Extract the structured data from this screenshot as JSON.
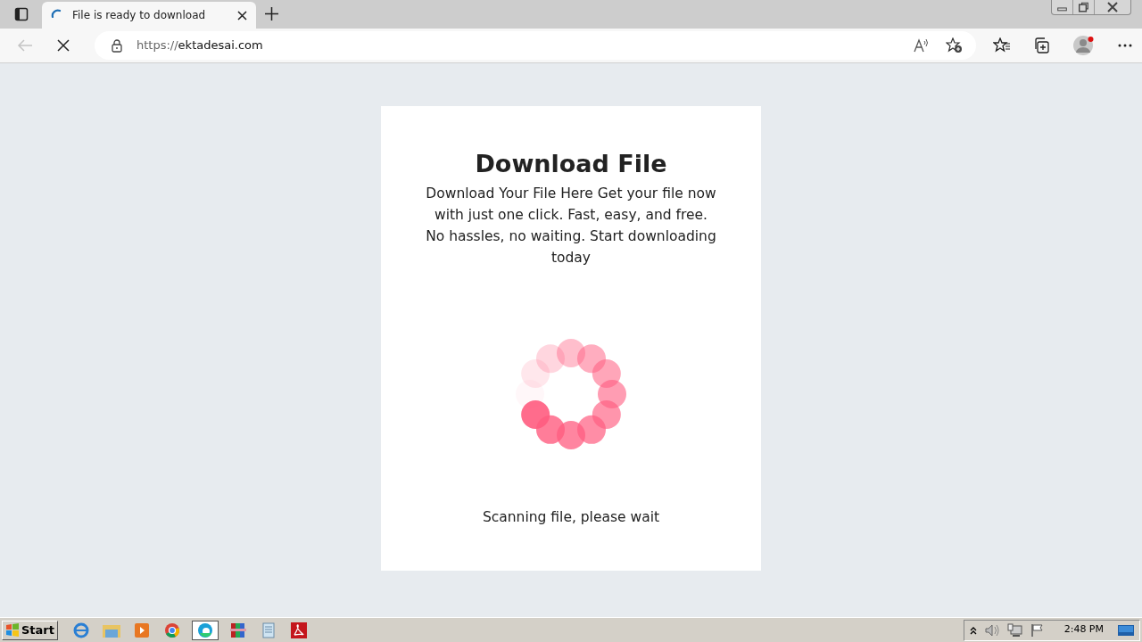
{
  "browser": {
    "tab": {
      "title": "File is ready to download",
      "selected": true
    },
    "address": {
      "scheme": "https://",
      "host": "ektadesai.com"
    }
  },
  "page": {
    "title": "Download File",
    "description": "Download Your File Here Get your file now with just one click. Fast, easy, and free. No hassles, no waiting. Start downloading today",
    "status": "Scanning file, please wait"
  },
  "taskbar": {
    "start": "Start",
    "clock": "2:48 PM"
  }
}
